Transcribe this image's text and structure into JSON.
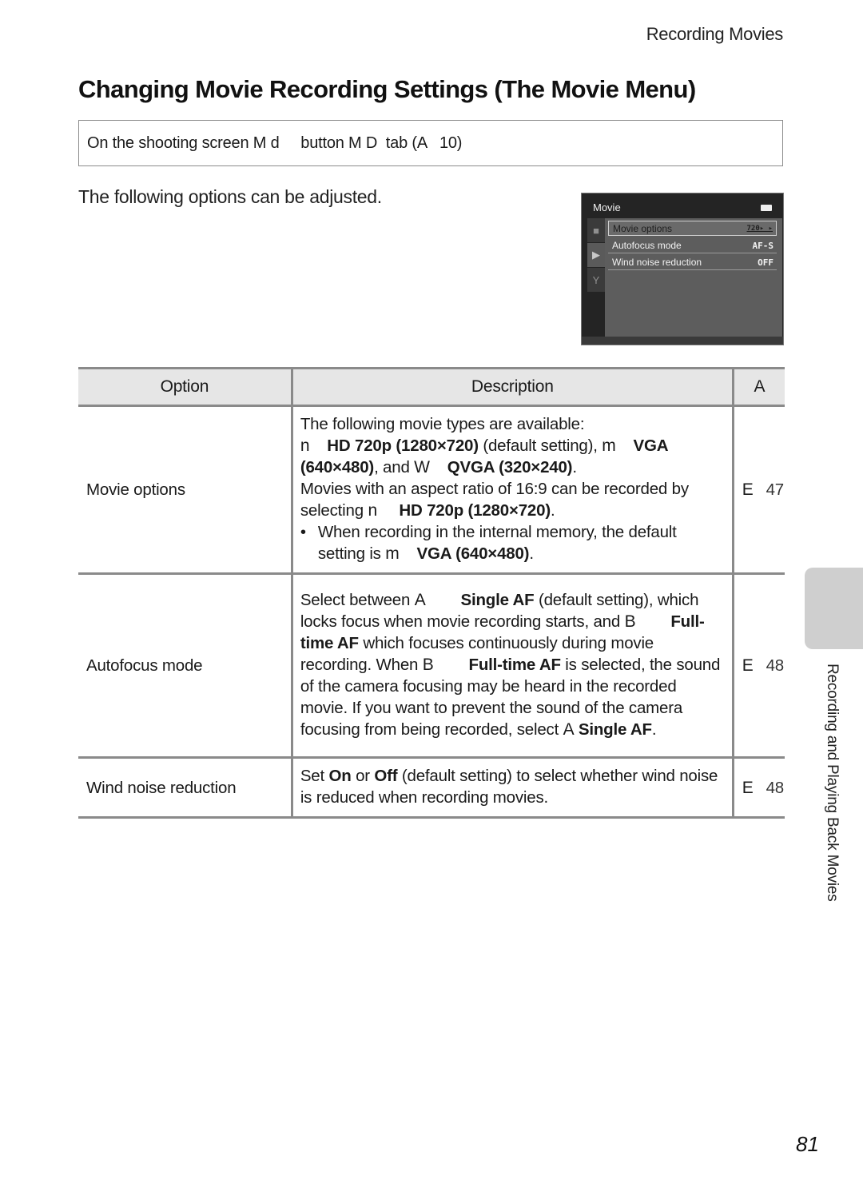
{
  "running_head": "Recording Movies",
  "title": "Changing Movie Recording Settings (The Movie Menu)",
  "nav_path": {
    "text": "On the shooting screen M d     button M D  tab (A   10)"
  },
  "intro": "The following options can be adjusted.",
  "camera_screen": {
    "title": "Movie",
    "battery_icon": "battery-icon",
    "tabs": [
      {
        "icon": "camera-icon",
        "glyph": "◘"
      },
      {
        "icon": "movie-camera-icon",
        "glyph": "🎥"
      },
      {
        "icon": "wrench-icon",
        "glyph": "ɣ"
      }
    ],
    "items": [
      {
        "label": "Movie options",
        "value": "720▸ ▸"
      },
      {
        "label": "Autofocus mode",
        "value": "AF-S"
      },
      {
        "label": "Wind noise reduction",
        "value": "OFF"
      }
    ]
  },
  "table": {
    "headers": {
      "option": "Option",
      "description": "Description",
      "ref": "A"
    },
    "rows": [
      {
        "option": "Movie options",
        "desc": {
          "l1": "The following movie types are available:",
          "s1": "n",
          "b1": "HD 720p (1280×720)",
          "t1": " (default setting), ",
          "s2": "m",
          "b2": "VGA (640×480)",
          "t2": ", and ",
          "s3": "W",
          "b3": "QVGA (320×240)",
          "t3": ".",
          "l2": "Movies with an aspect ratio of 16:9 can be recorded by selecting ",
          "s4": "n",
          "b4": "HD 720p (1280×720)",
          "t4": ".",
          "bullet": "•",
          "b_text": "When recording in the internal memory, the default setting is ",
          "s5": "m",
          "b5": "VGA (640×480)",
          "t5": "."
        },
        "ref_symbol": "E",
        "ref_page": "47"
      },
      {
        "option": "Autofocus mode",
        "desc": {
          "t1": "Select between ",
          "s1": "A",
          "b1": "Single AF",
          "t2": " (default setting), which locks focus when movie recording starts, and ",
          "s2": "B",
          "b2": "Full-time AF",
          "t3": " which focuses continuously during movie recording. When ",
          "s3": "B",
          "b3": "Full-time AF",
          "t4": " is selected, the sound of the camera focusing may be heard in the recorded movie. If you want to prevent the sound of the camera focusing from being recorded, select ",
          "s4": "A",
          "b4": "Single AF",
          "t5": "."
        },
        "ref_symbol": "E",
        "ref_page": "48"
      },
      {
        "option": "Wind noise reduction",
        "desc": {
          "t1": "Set ",
          "b1": "On",
          "t2": " or ",
          "b2": "Off",
          "t3": " (default setting) to select whether wind noise is reduced when recording movies."
        },
        "ref_symbol": "E",
        "ref_page": "48"
      }
    ]
  },
  "side_label": "Recording and Playing Back Movies",
  "page_number": "81"
}
